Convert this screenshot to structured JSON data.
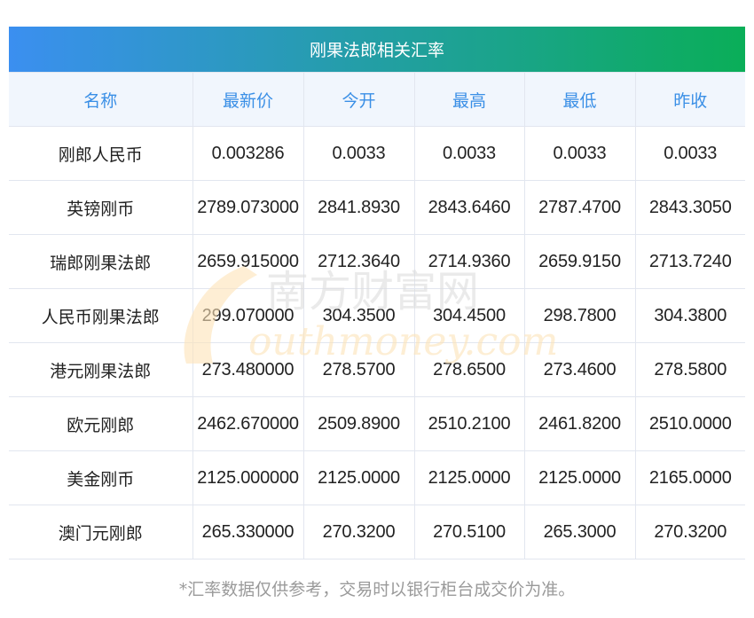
{
  "title": "刚果法郎相关汇率",
  "columns": [
    "名称",
    "最新价",
    "今开",
    "最高",
    "最低",
    "昨收"
  ],
  "rows": [
    [
      "刚郎人民币",
      "0.003286",
      "0.0033",
      "0.0033",
      "0.0033",
      "0.0033"
    ],
    [
      "英镑刚币",
      "2789.073000",
      "2841.8930",
      "2843.6460",
      "2787.4700",
      "2843.3050"
    ],
    [
      "瑞郎刚果法郎",
      "2659.915000",
      "2712.3640",
      "2714.9360",
      "2659.9150",
      "2713.7240"
    ],
    [
      "人民币刚果法郎",
      "299.070000",
      "304.3500",
      "304.4500",
      "298.7800",
      "304.3800"
    ],
    [
      "港元刚果法郎",
      "273.480000",
      "278.5700",
      "278.6500",
      "273.4600",
      "278.5800"
    ],
    [
      "欧元刚郎",
      "2462.670000",
      "2509.8900",
      "2510.2100",
      "2461.8200",
      "2510.0000"
    ],
    [
      "美金刚币",
      "2125.000000",
      "2125.0000",
      "2125.0000",
      "2125.0000",
      "2165.0000"
    ],
    [
      "澳门元刚郎",
      "265.330000",
      "270.3200",
      "270.5100",
      "265.3000",
      "270.3200"
    ]
  ],
  "footer": "*汇率数据仅供参考，交易时以银行柜台成交价为准。",
  "watermark": "南方财富网 southmoney.com",
  "colors": {
    "header_start": "#3b8ff0",
    "header_end": "#0aae58",
    "column_header_text": "#3a8fe6"
  }
}
